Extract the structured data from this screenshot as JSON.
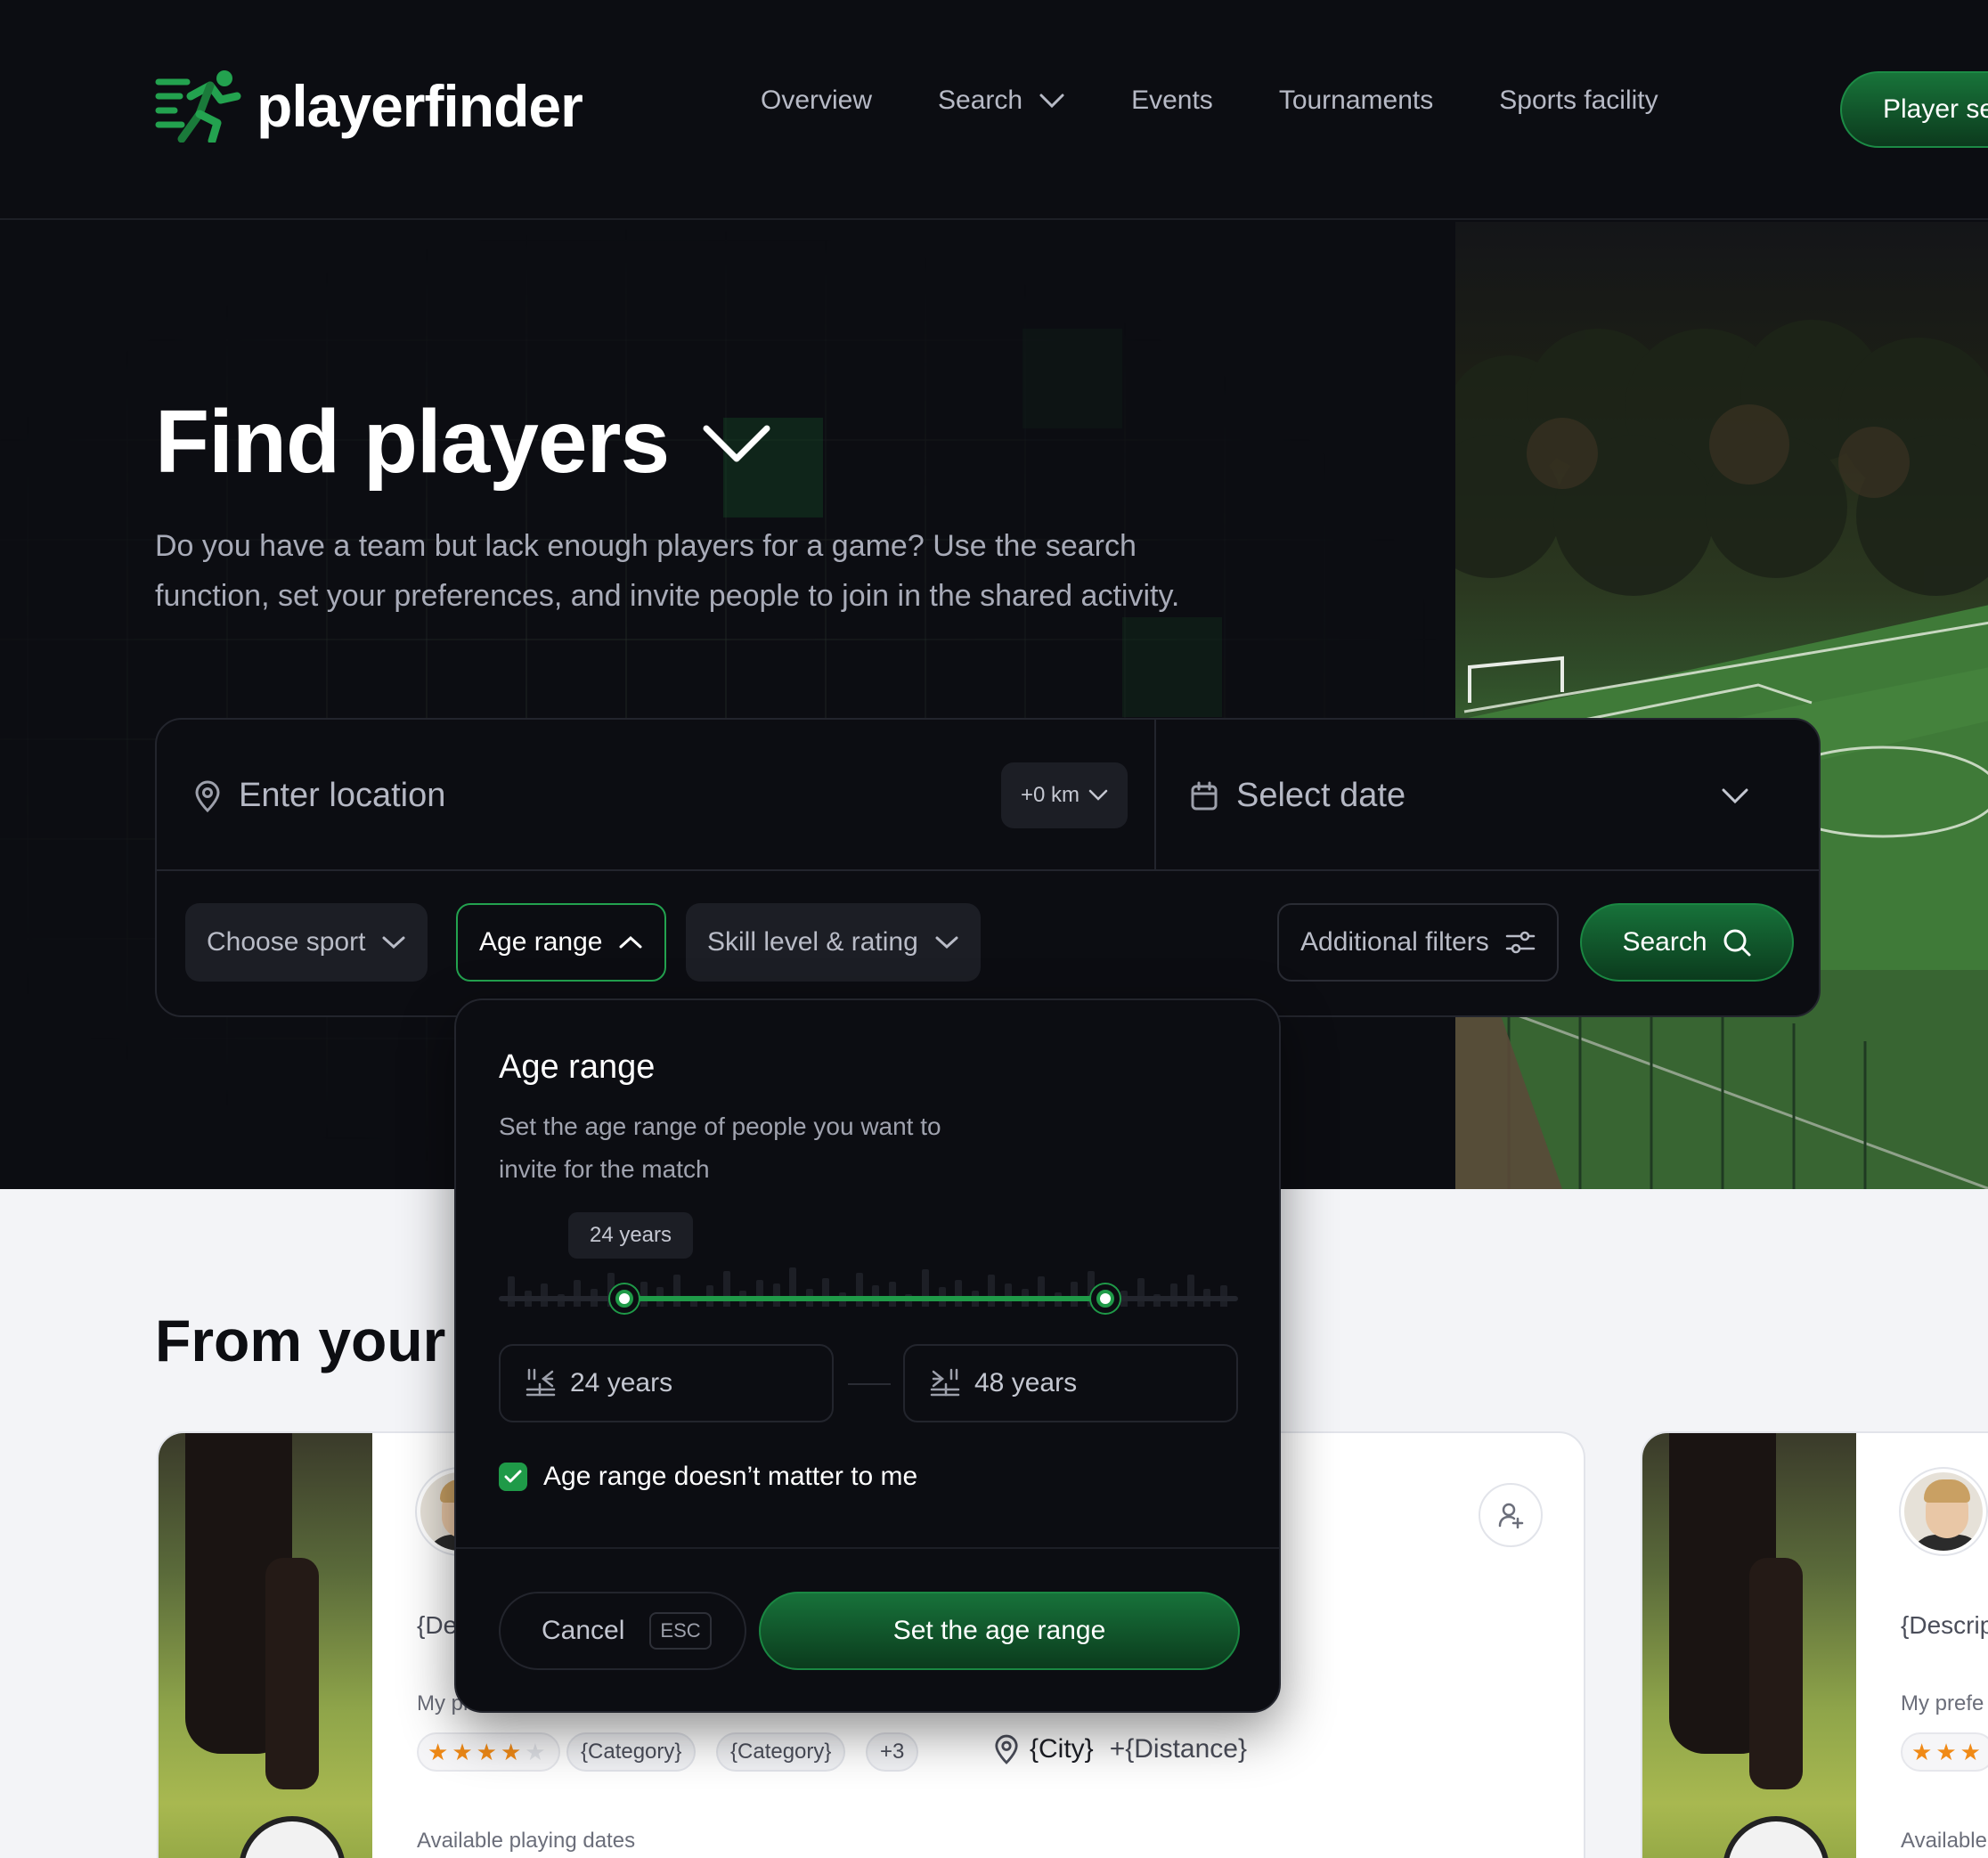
{
  "header": {
    "brand": "playerfinder",
    "nav": [
      {
        "label": "Overview"
      },
      {
        "label": "Search"
      },
      {
        "label": "Events"
      },
      {
        "label": "Tournaments"
      },
      {
        "label": "Sports facility"
      }
    ],
    "cta_label": "Player se"
  },
  "hero": {
    "title": "Find players",
    "subtitle": "Do you have a team but lack enough players for a game? Use the search function, set your preferences, and invite people to join in the shared activity."
  },
  "search": {
    "location_placeholder": "Enter location",
    "distance": "+0 km",
    "date_placeholder": "Select date",
    "filters": {
      "sport": "Choose sport",
      "age": "Age range",
      "skill": "Skill level & rating",
      "additional": "Additional filters"
    },
    "submit_label": "Search"
  },
  "age_popover": {
    "title": "Age range",
    "description": "Set the age range of people you want to invite for the match",
    "tooltip": "24 years",
    "min_value": "24 years",
    "max_value": "48 years",
    "slider": {
      "range_min": 0.17,
      "range_max": 0.82
    },
    "checkbox_label": "Age range doesn’t matter to me",
    "checkbox_checked": true,
    "cancel_label": "Cancel",
    "cancel_shortcut": "ESC",
    "confirm_label": "Set the age range"
  },
  "section": {
    "title": "From your "
  },
  "cards": [
    {
      "description": "{De",
      "prefs_label": "My preferences",
      "rating": 4,
      "categories": [
        "{Category}",
        "{Category}",
        "+3"
      ],
      "city": "{City}",
      "distance": "+{Distance}",
      "dates_label": "Available playing dates"
    },
    {
      "description": "{Descrip",
      "prefs_label": "My prefe",
      "dates_label": "Available"
    }
  ],
  "colors": {
    "accent": "#1f9a48",
    "background_dark": "#0c0d12",
    "background_light": "#f3f4f7",
    "star": "#f08a16"
  }
}
